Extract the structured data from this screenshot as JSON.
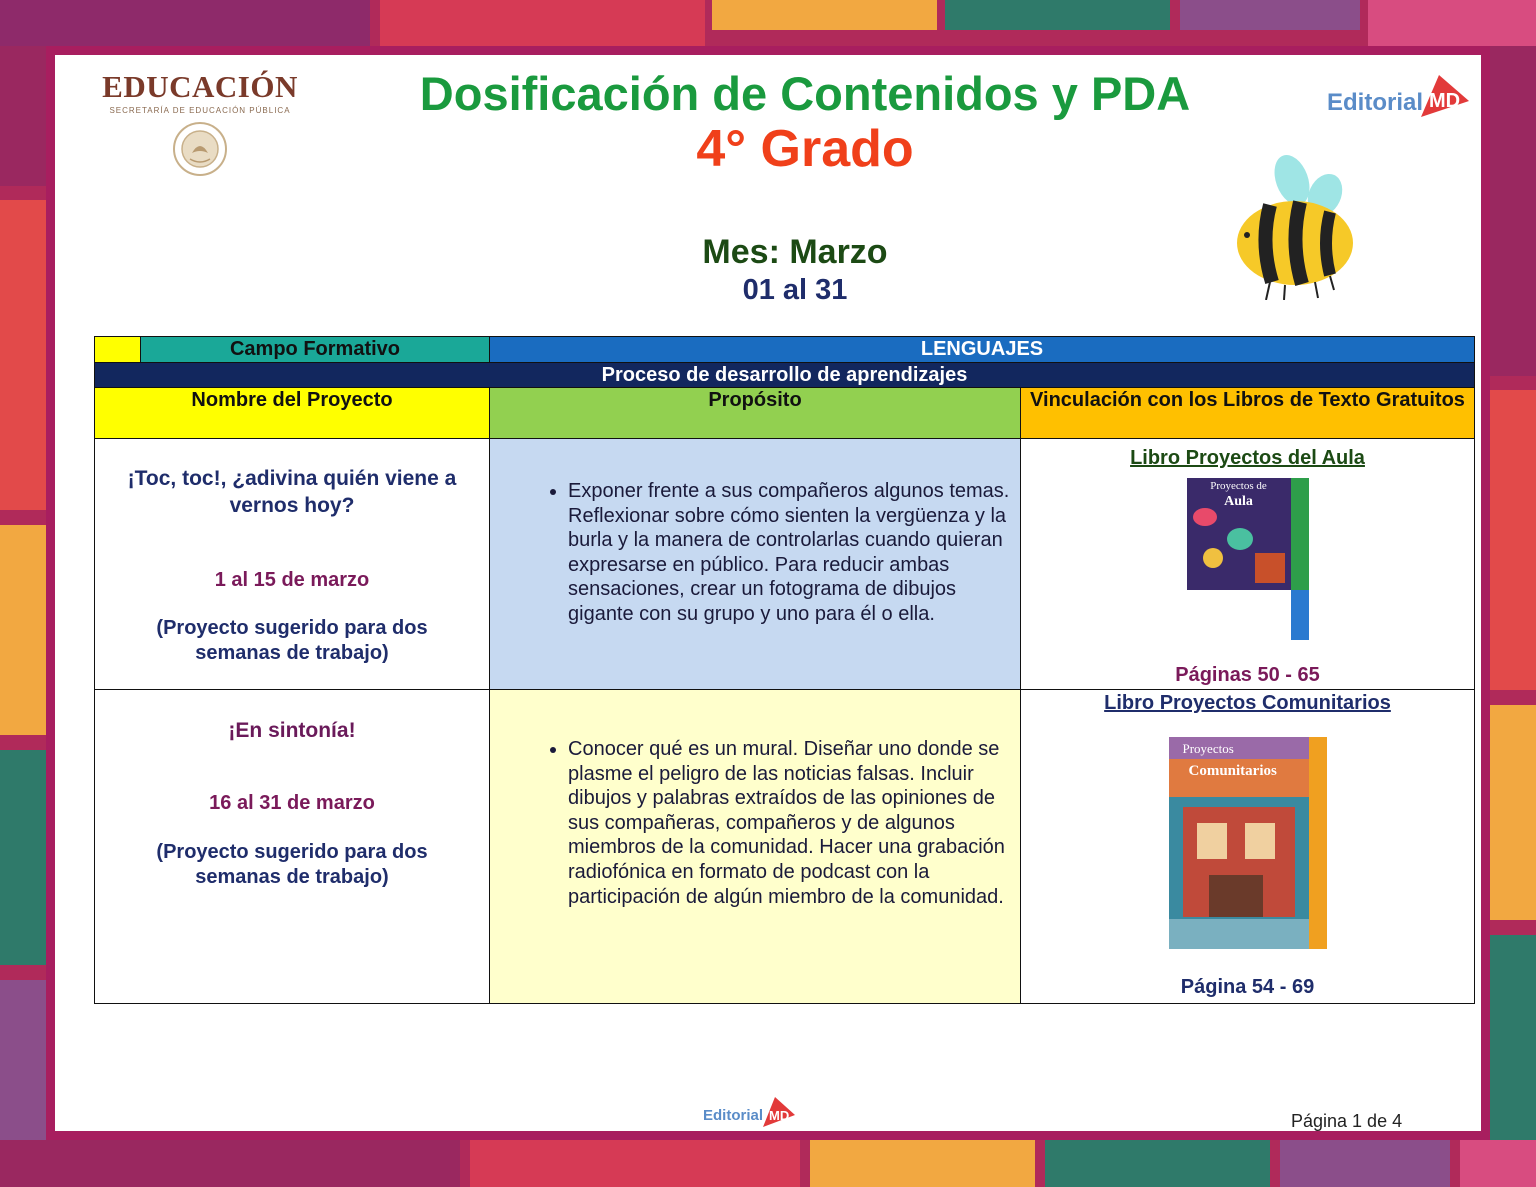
{
  "header": {
    "ministry": "EDUCACIÓN",
    "ministry_sub": "SECRETARÍA DE EDUCACIÓN PÚBLICA",
    "title": "Dosificación de Contenidos y PDA",
    "grade": "4° Grado",
    "month": "Mes: Marzo",
    "dates": "01 al 31",
    "publisher_text": "Editorial",
    "publisher_mark": "MD"
  },
  "table": {
    "campo_label": "Campo Formativo",
    "campo_value": "LENGUAJES",
    "process_label": "Proceso de desarrollo de aprendizajes",
    "columns": [
      "Nombre del Proyecto",
      "Propósito",
      "Vinculación con los Libros de Texto Gratuitos"
    ],
    "rows": [
      {
        "project": "¡Toc, toc!, ¿adivina quién viene a vernos hoy?",
        "dates": "1 al 15 de marzo",
        "note": "(Proyecto sugerido para dos semanas de trabajo)",
        "purpose": "Exponer frente a sus compañeros algunos temas. Reflexionar sobre cómo sienten la vergüenza y la burla y la manera de controlarlas cuando quieran expresarse en público. Para reducir ambas sensaciones, crear un fotograma de dibujos gigante con su grupo y uno para él o ella.",
        "book": "Libro Proyectos del Aula",
        "cover_title_1": "Proyectos de",
        "cover_title_2": "Aula",
        "pages": "Páginas 50 - 65"
      },
      {
        "project": "¡En sintonía!",
        "dates": "16 al 31 de marzo",
        "note": "(Proyecto sugerido para dos semanas de trabajo)",
        "purpose": "Conocer qué es un mural. Diseñar uno donde se plasme el peligro de las noticias falsas. Incluir dibujos y palabras extraídos de las opiniones de sus compañeras, compañeros y de algunos miembros de la comunidad. Hacer una grabación radiofónica en formato de podcast con la participación de algún miembro de la comunidad.",
        "book": "Libro Proyectos Comunitarios",
        "cover_title_1": "Proyectos",
        "cover_title_2": "Comunitarios",
        "pages": "Página 54 - 69"
      }
    ]
  },
  "footer": {
    "page_label": "Página 1 de 4"
  },
  "colors": {
    "title_green": "#1a9a3e",
    "grade_orange": "#f0401a",
    "month_green": "#1c4a14",
    "navy": "#1f2d6b",
    "maroon": "#7a1a5a",
    "frame": "#a81e5f"
  }
}
